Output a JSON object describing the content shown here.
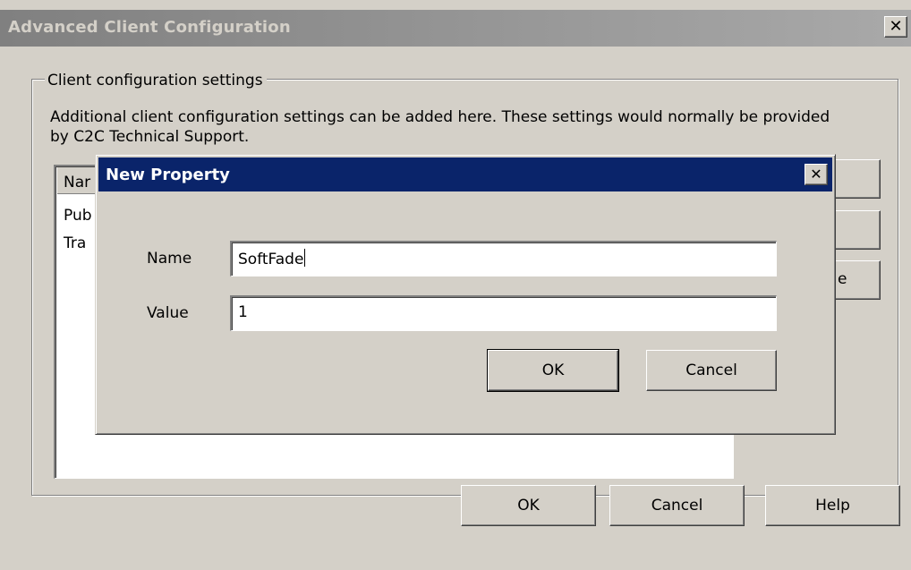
{
  "main_dialog": {
    "title": "Advanced Client Configuration",
    "close_glyph": "✕",
    "group": {
      "label": "Client configuration settings",
      "description": "Additional client configuration settings can be added here. These settings would normally be provided by C2C Technical Support.",
      "list": {
        "column_header": "Nar",
        "items": [
          "Pub",
          "Tra"
        ]
      },
      "side_buttons": [
        "",
        "",
        "e"
      ]
    },
    "buttons": {
      "ok": "OK",
      "cancel": "Cancel",
      "help": "Help"
    }
  },
  "new_property_dialog": {
    "title": "New Property",
    "close_glyph": "✕",
    "name_label": "Name",
    "name_value": "SoftFade",
    "value_label": "Value",
    "value_value": "1",
    "buttons": {
      "ok": "OK",
      "cancel": "Cancel"
    }
  },
  "colors": {
    "face": "#d4d0c8",
    "active_title": "#0a246a",
    "inactive_title": "#808080"
  },
  "icons": {
    "close": "close-icon"
  }
}
